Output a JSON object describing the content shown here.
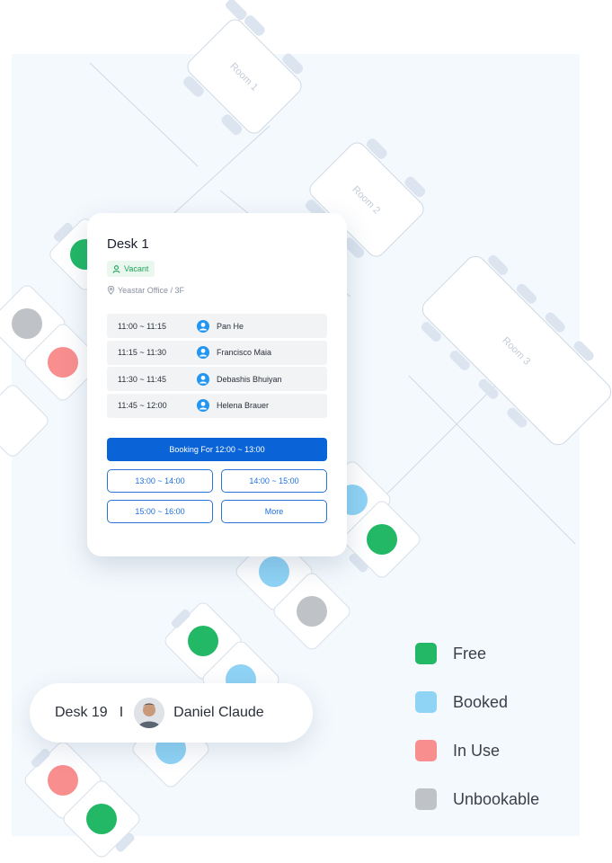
{
  "floor": {
    "rooms": [
      "Room 1",
      "Room 2",
      "Room 3"
    ],
    "status_colors": {
      "free": "#22b866",
      "booked": "#8fd3f5",
      "in_use": "#f98e8e",
      "unbookable": "#bfc3c7"
    }
  },
  "popup": {
    "title": "Desk 1",
    "status": "Vacant",
    "location": "Yeastar Office / 3F",
    "bookings": [
      {
        "time": "11:00 ~ 11:15",
        "name": "Pan He"
      },
      {
        "time": "11:15 ~ 11:30",
        "name": "Francisco Maia"
      },
      {
        "time": "11:30 ~ 11:45",
        "name": "Debashis Bhuiyan"
      },
      {
        "time": "11:45 ~ 12:00",
        "name": "Helena Brauer"
      }
    ],
    "primary_action": "Booking For 12:00 ~ 13:00",
    "slots": [
      "13:00 ~ 14:00",
      "14:00 ~ 15:00",
      "15:00 ~ 16:00",
      "More"
    ]
  },
  "desk_card": {
    "desk": "Desk 19",
    "separator": "I",
    "person": "Daniel Claude"
  },
  "legend": [
    {
      "label": "Free",
      "color": "#22b866"
    },
    {
      "label": "Booked",
      "color": "#8fd3f5"
    },
    {
      "label": "In Use",
      "color": "#f98e8e"
    },
    {
      "label": "Unbookable",
      "color": "#bfc3c7"
    }
  ]
}
